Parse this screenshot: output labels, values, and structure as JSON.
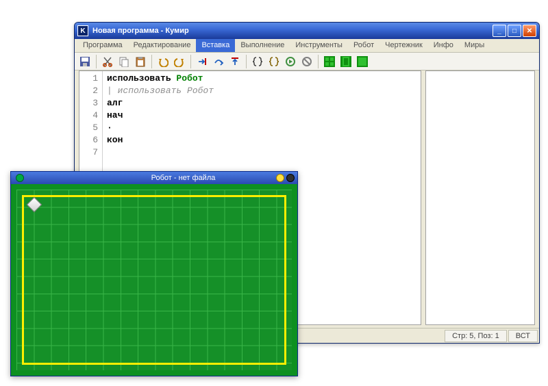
{
  "main_window": {
    "title": "Новая программа - Кумир",
    "app_icon_letter": "K"
  },
  "menus": [
    "Программа",
    "Редактирование",
    "Вставка",
    "Выполнение",
    "Инструменты",
    "Робот",
    "Чертежник",
    "Инфо",
    "Миры"
  ],
  "active_menu_index": 2,
  "toolbar": [
    {
      "name": "save-icon",
      "svg": "save"
    },
    {
      "sep": true
    },
    {
      "name": "cut-icon",
      "svg": "cut"
    },
    {
      "name": "copy-icon",
      "svg": "copy"
    },
    {
      "name": "paste-icon",
      "svg": "paste"
    },
    {
      "sep": true
    },
    {
      "name": "undo-icon",
      "svg": "undo"
    },
    {
      "name": "redo-icon",
      "svg": "redo"
    },
    {
      "sep": true
    },
    {
      "name": "step-into-icon",
      "svg": "stepin"
    },
    {
      "name": "step-over-icon",
      "svg": "stepover"
    },
    {
      "name": "step-out-icon",
      "svg": "stepout"
    },
    {
      "sep": true
    },
    {
      "name": "braces-icon",
      "svg": "braces"
    },
    {
      "name": "braces2-icon",
      "svg": "braces2"
    },
    {
      "name": "run-icon",
      "svg": "run"
    },
    {
      "name": "stop-icon",
      "svg": "stop"
    },
    {
      "sep": true
    },
    {
      "name": "grid1-icon",
      "svg": "grid1"
    },
    {
      "name": "grid2-icon",
      "svg": "grid2"
    },
    {
      "name": "grid3-icon",
      "svg": "grid3"
    }
  ],
  "code_lines": [
    {
      "n": 1,
      "segments": [
        {
          "t": "использовать ",
          "c": ""
        },
        {
          "t": "Робот",
          "c": "kw-green"
        }
      ]
    },
    {
      "n": 2,
      "segments": [
        {
          "t": "| использовать Робот",
          "c": "kw-gray"
        }
      ]
    },
    {
      "n": 3,
      "segments": [
        {
          "t": "алг",
          "c": ""
        }
      ]
    },
    {
      "n": 4,
      "segments": [
        {
          "t": "нач",
          "c": ""
        }
      ]
    },
    {
      "n": 5,
      "segments": [
        {
          "t": "·",
          "c": ""
        }
      ]
    },
    {
      "n": 6,
      "segments": [
        {
          "t": "кон",
          "c": ""
        }
      ]
    },
    {
      "n": 7,
      "segments": [
        {
          "t": "",
          "c": ""
        }
      ]
    }
  ],
  "status": {
    "pos": "Стр: 5, Поз: 1",
    "mode": "ВСТ"
  },
  "robot_window": {
    "title": "Робот - нет файла"
  }
}
